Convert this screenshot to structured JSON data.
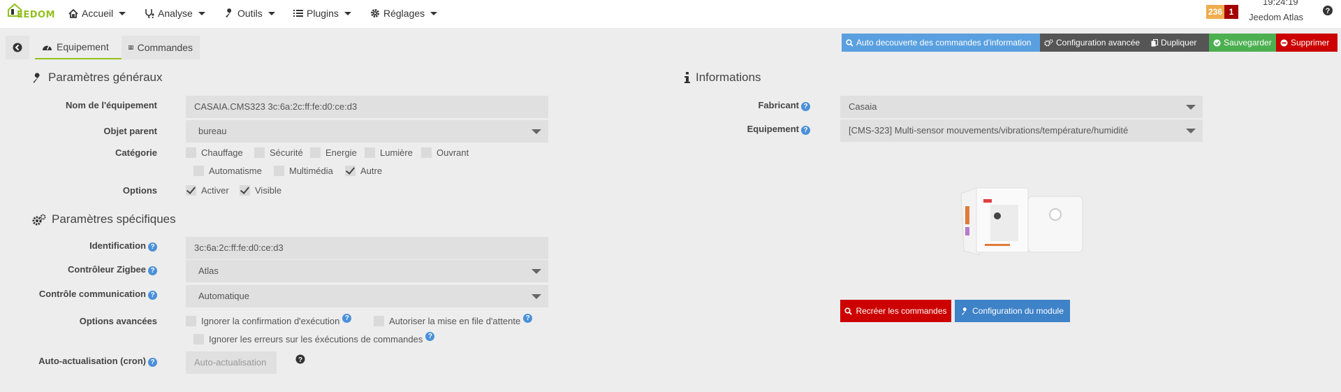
{
  "navbar": {
    "brand": "EEDOM",
    "menu": [
      {
        "label": "Accueil",
        "icon": "home-icon"
      },
      {
        "label": "Analyse",
        "icon": "stethoscope-icon"
      },
      {
        "label": "Outils",
        "icon": "wrench-icon"
      },
      {
        "label": "Plugins",
        "icon": "list-icon"
      },
      {
        "label": "Réglages",
        "icon": "gear-icon"
      }
    ],
    "badge_messages": "236",
    "badge_updates": "1",
    "clock": "19:24:19",
    "hostname": "Jeedom Atlas"
  },
  "tabs": {
    "equipement": "Equipement",
    "commandes": "Commandes"
  },
  "toolbar": {
    "auto_discovery": "Auto decouverte des commandes d'information",
    "advanced_config": "Configuration avancée",
    "duplicate": "Dupliquer",
    "save": "Sauvegarder",
    "delete": "Supprimer"
  },
  "general": {
    "title": "Paramètres généraux",
    "name_label": "Nom de l'équipement",
    "name_value": "CASAIA.CMS323 3c:6a:2c:ff:fe:d0:ce:d3",
    "parent_label": "Objet parent",
    "parent_value": "bureau",
    "category_label": "Catégorie",
    "categories": [
      {
        "label": "Chauffage",
        "checked": false
      },
      {
        "label": "Sécurité",
        "checked": false
      },
      {
        "label": "Energie",
        "checked": false
      },
      {
        "label": "Lumière",
        "checked": false
      },
      {
        "label": "Ouvrant",
        "checked": false
      },
      {
        "label": "Automatisme",
        "checked": false
      },
      {
        "label": "Multimédia",
        "checked": false
      },
      {
        "label": "Autre",
        "checked": true
      }
    ],
    "options_label": "Options",
    "options": [
      {
        "label": "Activer",
        "checked": true
      },
      {
        "label": "Visible",
        "checked": true
      }
    ]
  },
  "specific": {
    "title": "Paramètres spécifiques",
    "identification_label": "Identification",
    "identification_value": "3c:6a:2c:ff:fe:d0:ce:d3",
    "controller_label": "Contrôleur Zigbee",
    "controller_value": "Atlas",
    "comm_label": "Contrôle communication",
    "comm_value": "Automatique",
    "advanced_label": "Options avancées",
    "advanced_options": [
      {
        "label": "Ignorer la confirmation d'exécution",
        "checked": false
      },
      {
        "label": "Autoriser la mise en file d'attente",
        "checked": false
      },
      {
        "label": "Ignorer les erreurs sur les éxécutions de commandes",
        "checked": false
      }
    ],
    "cron_label": "Auto-actualisation (cron)",
    "cron_placeholder": "Auto-actualisation"
  },
  "informations": {
    "title": "Informations",
    "manufacturer_label": "Fabricant",
    "manufacturer_value": "Casaia",
    "device_label": "Equipement",
    "device_value": "[CMS-323] Multi-sensor mouvements/vibrations/température/humidité",
    "recreate_button": "Recréer les commandes",
    "module_config_button": "Configuration du module"
  },
  "colors": {
    "accent": "#94c11f",
    "primary_blue": "#5aa0e0",
    "danger": "#cc0000",
    "success": "#4caf50",
    "warning": "#f0ad4e"
  }
}
